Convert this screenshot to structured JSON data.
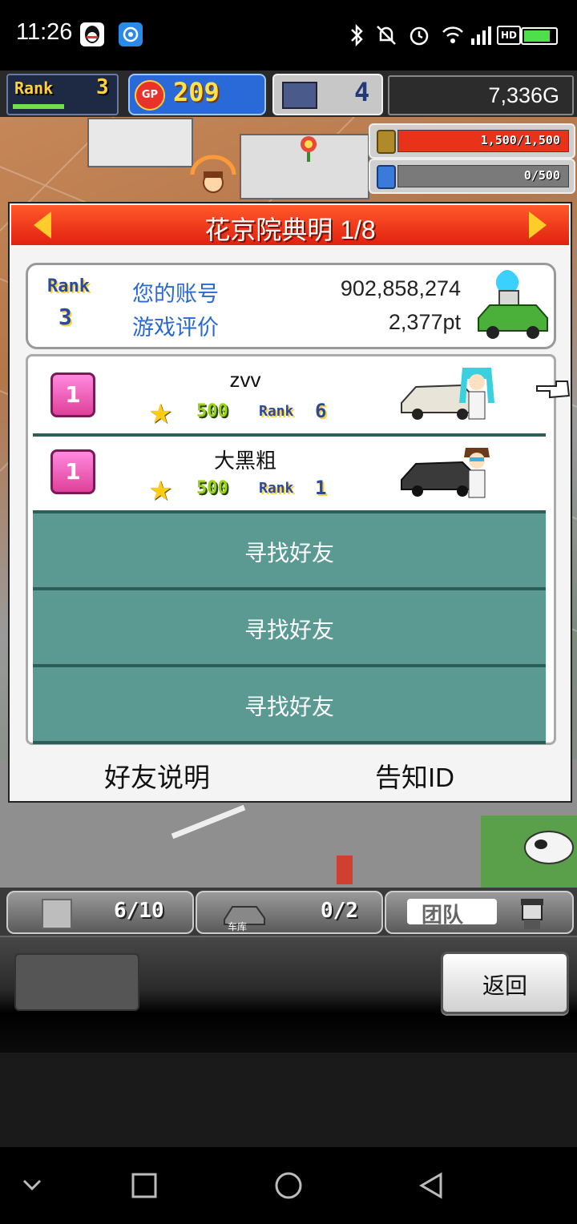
{
  "status_bar": {
    "time": "11:26",
    "icons": [
      "qq-icon",
      "app-icon",
      "bluetooth-icon",
      "mute-icon",
      "alarm-icon",
      "wifi-icon",
      "signal-4g-icon",
      "hd-icon",
      "battery-icon"
    ]
  },
  "hud": {
    "rank_label": "Rank",
    "rank_value": "3",
    "gp_label": "GP",
    "gp_value": "209",
    "pc_value": "4",
    "money": "7,336G"
  },
  "meters": {
    "fuel": {
      "text": "1,500/1,500",
      "fill_fraction": 1.0,
      "color": "#e8321a"
    },
    "research": {
      "text": "0/500",
      "fill_fraction": 0.0,
      "color": "#3a7ad8"
    }
  },
  "panel": {
    "title": "花京院典明 1/8",
    "account": {
      "rank_label": "Rank",
      "rank_value": "3",
      "id_label": "您的账号",
      "id_value": "902,858,274",
      "eval_label": "游戏评价",
      "eval_value": "2,377pt"
    },
    "friends": [
      {
        "badge": "1",
        "name": "zvv",
        "score": "500",
        "rank_label": "Rank",
        "rank": "6"
      },
      {
        "badge": "1",
        "name": "大黑粗",
        "score": "500",
        "rank_label": "Rank",
        "rank": "1"
      }
    ],
    "find_friend_label": "寻找好友",
    "friend_help": "好友说明",
    "notify_id": "告知ID"
  },
  "bottom_tabs": {
    "garage_count": "6/10",
    "garage_label": "车库",
    "car_count": "0/2",
    "team_label": "团队"
  },
  "command": {
    "back_label": "返回"
  },
  "colors": {
    "title_red": "#e22010",
    "teal_row": "#5a9a92",
    "blue_label": "#2a6ad0"
  }
}
